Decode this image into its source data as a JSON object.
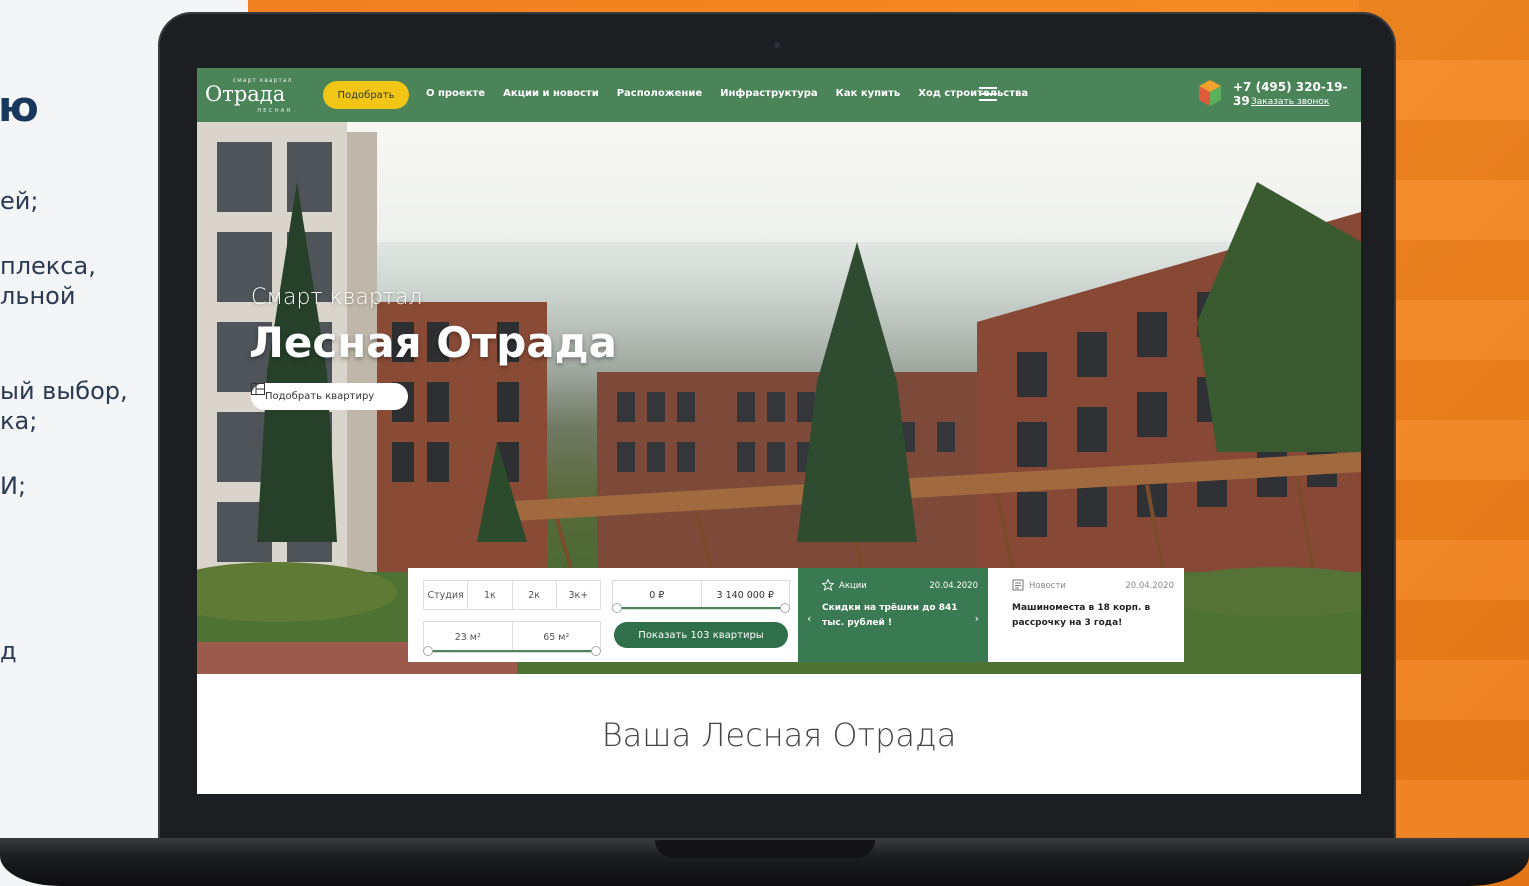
{
  "slide": {
    "heading": "ю",
    "lines": [
      "ей;",
      "плекса,",
      "льной",
      "ый выбор,",
      "ка;",
      "И;",
      "д"
    ]
  },
  "site": {
    "logo": {
      "main": "Отрада",
      "small": "смарт квартал",
      "sub": "ЛЕСНАЯ"
    },
    "pick_button": "Подобрать",
    "nav": [
      "О проекте",
      "Акции и новости",
      "Расположение",
      "Инфраструктура",
      "Как купить",
      "Ход строительства"
    ],
    "phone": "+7 (495) 320-19-39",
    "callback": "Заказать звонок"
  },
  "hero": {
    "subtitle": "Смарт квартал",
    "title": "Лесная Отрада",
    "button": "Подобрать квартиру"
  },
  "filter": {
    "rooms": [
      "Студия",
      "1к",
      "2к",
      "3к+"
    ],
    "area": [
      "23 м²",
      "65 м²"
    ],
    "price": [
      "0 ₽",
      "3 140 000 ₽"
    ],
    "show_button": "Показать 103 квартиры"
  },
  "promo": {
    "category": "Акции",
    "date": "20.04.2020",
    "text": "Скидки на трёшки до 841 тыс. рублей !"
  },
  "news": {
    "category": "Новости",
    "date": "20.04.2020",
    "text": "Машиноместа в 18 корп. в рассрочку на 3 года!"
  },
  "section_title": "Ваша Лесная Отрада",
  "colors": {
    "header_green": "#4a8458",
    "button_yellow": "#f2c617",
    "dark_green": "#2f6f49",
    "orange": "#f0801e"
  }
}
